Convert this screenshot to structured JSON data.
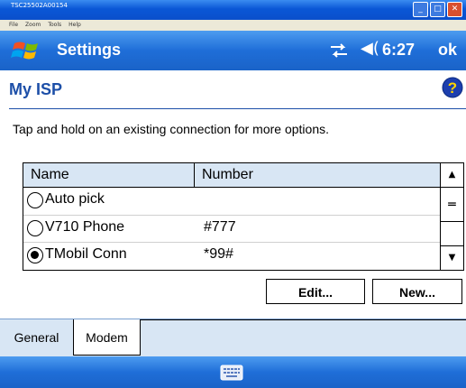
{
  "outer_window": {
    "title": "TSC25502A00154",
    "menu": [
      "File",
      "Zoom",
      "Tools",
      "Help"
    ],
    "buttons": [
      "minimize",
      "maximize",
      "close"
    ]
  },
  "nav": {
    "title": "Settings",
    "time": "6:27",
    "ok_label": "ok",
    "icons": [
      "windows-start-icon",
      "connectivity-icon",
      "volume-icon"
    ]
  },
  "page": {
    "title": "My ISP",
    "instructions": "Tap and hold on an existing connection for more options."
  },
  "listview": {
    "columns": [
      "Name",
      "Number"
    ],
    "rows": [
      {
        "name": "Auto pick",
        "number": "",
        "selected": false
      },
      {
        "name": "V710 Phone",
        "number": "#777",
        "selected": false
      },
      {
        "name": "TMobil Conn",
        "number": "*99#",
        "selected": true
      }
    ]
  },
  "buttons": {
    "edit": "Edit...",
    "new": "New..."
  },
  "tabs": [
    "General",
    "Modem"
  ],
  "active_tab": "Modem",
  "colors": {
    "title_bar_blue": "#1f6ed8",
    "header_text_blue": "#1d4fa8",
    "tab_strip_bg": "#d8e6f4"
  }
}
